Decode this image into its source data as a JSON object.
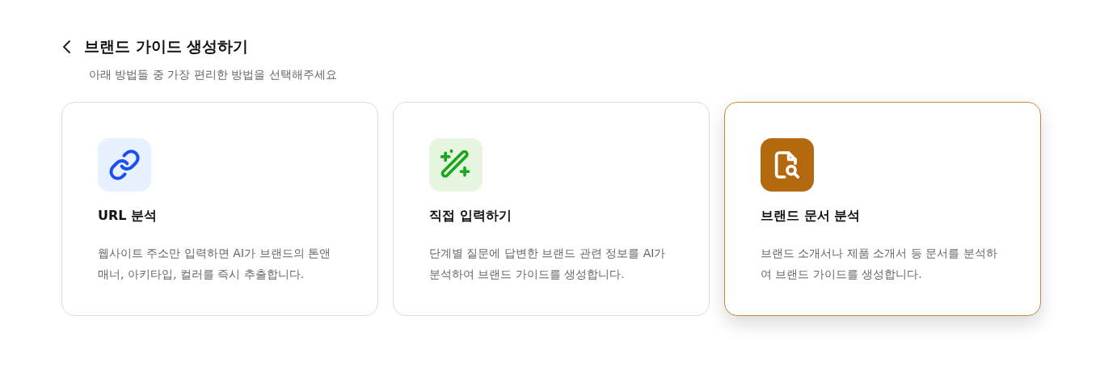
{
  "header": {
    "title": "브랜드 가이드 생성하기",
    "subtitle": "아래 방법들 중 가장 편리한 방법을 선택해주세요"
  },
  "options": [
    {
      "kind": "link",
      "title": "URL 분석",
      "description": "웹사이트 주소만 입력하면 AI가 브랜드의 톤앤 매너, 아키타입, 컬러를 즉시 추출합니다.",
      "selected": false
    },
    {
      "kind": "wand",
      "title": "직접 입력하기",
      "description": "단계별 질문에 답변한 브랜드 관련 정보를 AI가 분석하여 브랜드 가이드를 생성합니다.",
      "selected": false
    },
    {
      "kind": "document",
      "title": "브랜드 문서 분석",
      "description": "브랜드 소개서나 제품 소개서 등 문서를 분석하여 브랜드 가이드를 생성합니다.",
      "selected": true
    }
  ]
}
